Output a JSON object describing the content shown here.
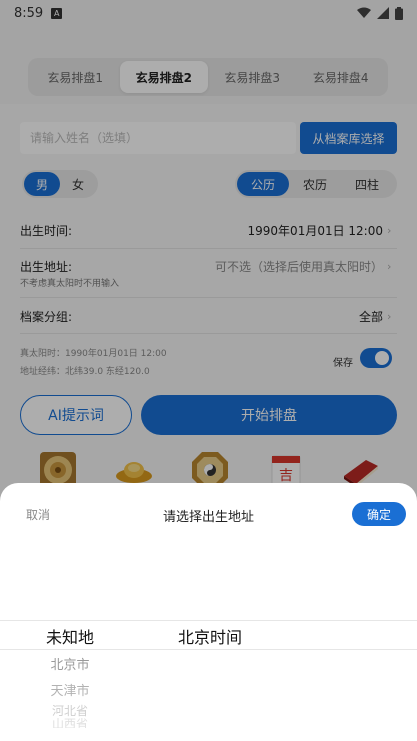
{
  "status": {
    "time": "8:59"
  },
  "tabs": [
    "玄易排盘1",
    "玄易排盘2",
    "玄易排盘3",
    "玄易排盘4"
  ],
  "form": {
    "name_placeholder": "请输入姓名（选填）",
    "archive_button": "从档案库选择",
    "gender": {
      "male": "男",
      "female": "女",
      "selected": "男"
    },
    "calendar": {
      "solar": "公历",
      "lunar": "农历",
      "pillars": "四柱",
      "selected": "公历"
    },
    "birth_time": {
      "label": "出生时间:",
      "value": "1990年01月01日 12:00"
    },
    "birth_place": {
      "label": "出生地址:",
      "value": "可不选（选择后使用真太阳时）",
      "hint": "不考虑真太阳时不用输入"
    },
    "group": {
      "label": "档案分组:",
      "value": "全部"
    },
    "true_solar_time": "真太阳时：1990年01月01日 12:00",
    "coords": "地址经纬：北纬39.0 东经120.0",
    "save_label": "保存",
    "save_enabled": true,
    "ai_button": "AI提示词",
    "start_button": "开始排盘"
  },
  "icons": [
    "luopan-icon",
    "gold-ingot-icon",
    "bagua-icon",
    "calendar-ji-icon",
    "book-icon"
  ],
  "sheet": {
    "cancel": "取消",
    "title": "请选择出生地址",
    "confirm": "确定",
    "col1": [
      "未知地",
      "北京市",
      "天津市",
      "河北省",
      "山西省"
    ],
    "col2": [
      "北京时间"
    ]
  },
  "colors": {
    "accent": "#1a6fd4"
  }
}
